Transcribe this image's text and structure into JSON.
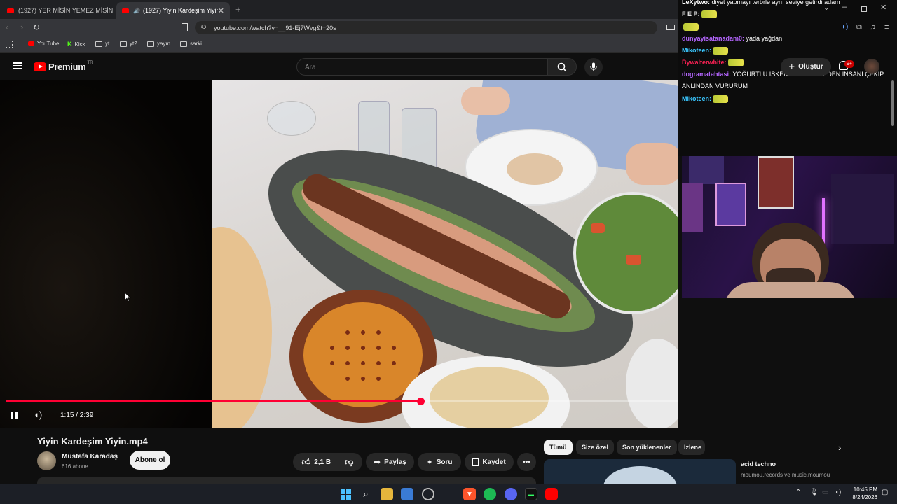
{
  "browser": {
    "tabs": [
      {
        "label": "(1927) YER MİSİN YEMEZ MİSİN SERİ"
      },
      {
        "label": "(1927) Yiyin Kardeşim Yiyin.m"
      }
    ],
    "url": "youtube.com/watch?v=__91-Ej7Wvg&t=20s",
    "bookmarks": [
      "YouTube",
      "Kick",
      "yt",
      "yt2",
      "yayın",
      "sarki"
    ]
  },
  "youtube": {
    "logo_text": "Premium",
    "logo_badge": "TR",
    "search_placeholder": "Ara",
    "create_label": "Oluştur",
    "notif_badge": "9+"
  },
  "player": {
    "time": "1:15 / 2:39",
    "progress": 0.472
  },
  "video": {
    "title": "Yiyin Kardeşim Yiyin.mp4",
    "channel": "Mustafa Karadaş",
    "subs": "616 abone",
    "subscribe": "Abone ol",
    "likes": "2,1 B",
    "share": "Paylaş",
    "ask": "Soru",
    "save": "Kaydet"
  },
  "chips": [
    "Tümü",
    "Size özel",
    "Son yüklenenler",
    "İzlene"
  ],
  "recommendation": {
    "title": "acid techno",
    "channel": "moumou.records ve music.moumou"
  },
  "chat": [
    {
      "user": "LeXytwo",
      "msg": "diyet yapmayı terörle aynı seviye getirdi adam",
      "color": "#ffffff"
    },
    {
      "user": "F E P",
      "msg": "",
      "color": "#e0e0e0"
    },
    {
      "user": "",
      "msg": "",
      "color": "#ff3355"
    },
    {
      "user": "dunyayisatanadam0",
      "msg": "yada yağdan",
      "color": "#b566ff"
    },
    {
      "user": "Mikoteen",
      "msg": "",
      "color": "#3ac7ff"
    },
    {
      "user": "Bywalterwhite",
      "msg": "",
      "color": "#ff2255"
    },
    {
      "user": "dogramatahtasi",
      "msg": "YOĞURTLU İSKENDERİ REDDEDEN İNSANI ÇEKİP",
      "color": "#b566ff"
    },
    {
      "user": "",
      "msg": "ANLINDAN VURURUM",
      "color": "#ffffff"
    },
    {
      "user": "Mikoteen",
      "msg": "",
      "color": "#3ac7ff"
    }
  ],
  "system": {
    "time": "10:45 PM",
    "date": "8/24/2026"
  }
}
